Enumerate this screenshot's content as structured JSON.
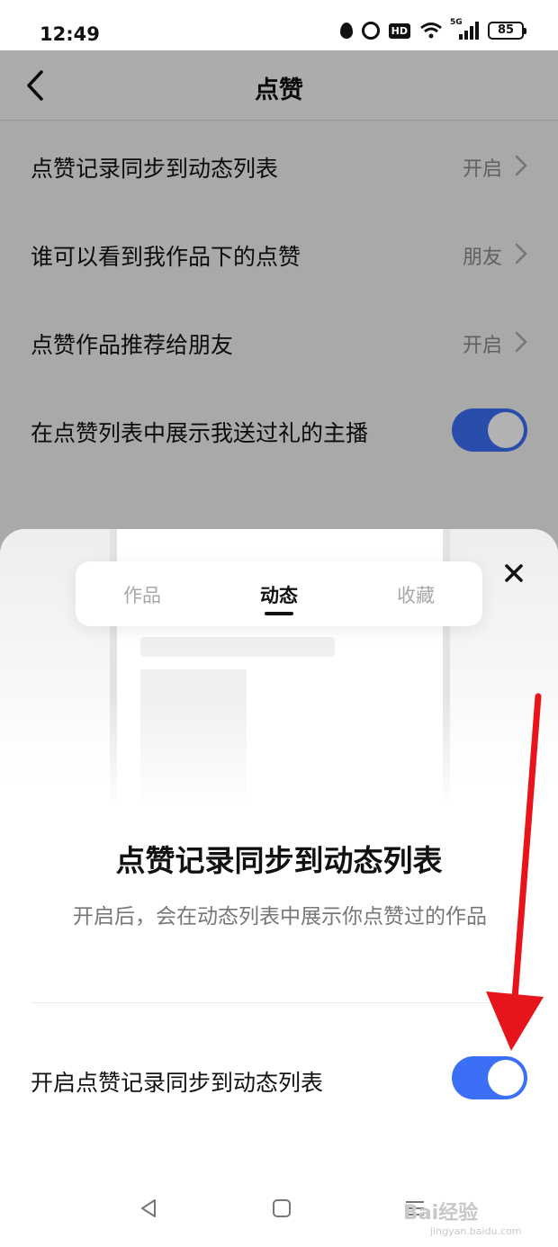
{
  "status_bar": {
    "time": "12:49",
    "network": "5G",
    "battery": "85",
    "icons": [
      "water-drop-icon",
      "alarm-icon",
      "hd-icon",
      "wifi-icon",
      "signal-icon",
      "battery-icon"
    ]
  },
  "header": {
    "title": "点赞",
    "back_icon": "chevron-left-icon"
  },
  "settings": [
    {
      "label": "点赞记录同步到动态列表",
      "value": "开启",
      "type": "link"
    },
    {
      "label": "谁可以看到我作品下的点赞",
      "value": "朋友",
      "type": "link"
    },
    {
      "label": "点赞作品推荐给朋友",
      "value": "开启",
      "type": "link"
    },
    {
      "label": "在点赞列表中展示我送过礼的主播",
      "type": "toggle",
      "on": true
    }
  ],
  "sheet": {
    "tabs": [
      "作品",
      "动态",
      "收藏"
    ],
    "active_tab": "动态",
    "title": "点赞记录同步到动态列表",
    "description": "开启后，会在动态列表中展示你点赞过的作品",
    "toggle_label": "开启点赞记录同步到动态列表",
    "toggle_on": true
  },
  "watermark": {
    "text": "Bai经验",
    "sub": "jingyan.baidu.com"
  },
  "colors": {
    "accent": "#3b6ff5",
    "annotation": "#e8141c",
    "dim_overlay": "rgba(0,0,0,0.30)"
  }
}
